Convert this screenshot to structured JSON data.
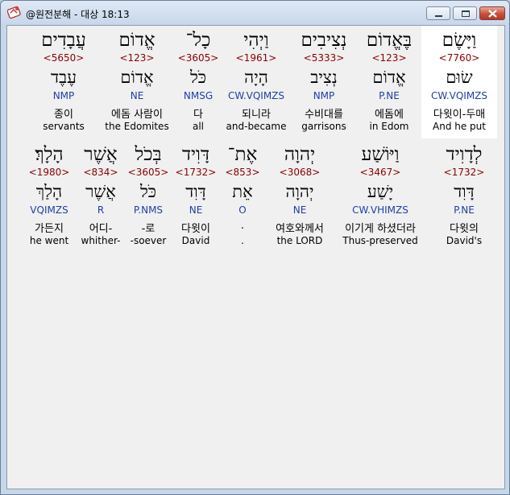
{
  "window": {
    "title": "@원전분해 - 대상 18:13"
  },
  "icons": {
    "app": "bible-app-icon",
    "minimize": "minimize-icon",
    "maximize": "maximize-icon",
    "close": "close-icon"
  },
  "rows": [
    {
      "words": [
        {
          "hebrew": "עֲבָדִים",
          "strong": "<5650>",
          "lemma": "עֶבֶד",
          "parse": "NMP",
          "korean": "종이",
          "english": "servants"
        },
        {
          "hebrew": "אֱדוֹם",
          "strong": "<123>",
          "lemma": "אֱדוֹם",
          "parse": "NE",
          "korean": "에돔 사람이",
          "english": "the Edomites"
        },
        {
          "hebrew": "כָל־",
          "strong": "<3605>",
          "lemma": "כֹּל",
          "parse": "NMSG",
          "korean": "다",
          "english": "all"
        },
        {
          "hebrew": "וַיְהִי",
          "strong": "<1961>",
          "lemma": "הָיָה",
          "parse": "CW.VQIMZS",
          "korean": "되니라",
          "english": "and-became"
        },
        {
          "hebrew": "נְצִיבִים",
          "strong": "<5333>",
          "lemma": "נְצִיב",
          "parse": "NMP",
          "korean": "수비대를",
          "english": "garrisons"
        },
        {
          "hebrew": "בֶּאֱדוֹם",
          "strong": "<123>",
          "lemma": "אֱדוֹם",
          "parse": "P.NE",
          "korean": "에돔에",
          "english": "in Edom"
        },
        {
          "hebrew": "וַיָּשֶׂם",
          "strong": "<7760>",
          "lemma": "שׂוּם",
          "parse": "CW.VQIMZS",
          "korean": "다윗이-두매",
          "english": "And he put",
          "selected": true
        }
      ]
    },
    {
      "words": [
        {
          "hebrew": "הָלָךְ׃",
          "strong": "<1980>",
          "lemma": "הָלַךְ",
          "parse": "VQIMZS",
          "korean": "가든지",
          "english": "he went"
        },
        {
          "hebrew": "אֲשֶׁר",
          "strong": "<834>",
          "lemma": "אֲשֶׁר",
          "parse": "R",
          "korean": "어디-",
          "english": "whither-"
        },
        {
          "hebrew": "בְּכֹל",
          "strong": "<3605>",
          "lemma": "כֹּל",
          "parse": "P.NMS",
          "korean": "-로",
          "english": "-soever"
        },
        {
          "hebrew": "דָּוִיד",
          "strong": "<1732>",
          "lemma": "דָּוִד",
          "parse": "NE",
          "korean": "다윗이",
          "english": "David"
        },
        {
          "hebrew": "אֶת־",
          "strong": "<853>",
          "lemma": "אֵת",
          "parse": "O",
          "korean": ".",
          "english": "."
        },
        {
          "hebrew": "יְהוָה",
          "strong": "<3068>",
          "lemma": "יְהוָה",
          "parse": "NE",
          "korean": "여호와께서",
          "english": "the LORD"
        },
        {
          "hebrew": "וַיּוֹשַׁע",
          "strong": "<3467>",
          "lemma": "יָשַׁע",
          "parse": "CW.VHIMZS",
          "korean": "이기게 하셨더라",
          "english": "Thus-preserved"
        },
        {
          "hebrew": "לְדָוִיד",
          "strong": "<1732>",
          "lemma": "דָּוִד",
          "parse": "P.NE",
          "korean": "다윗의",
          "english": "David's"
        }
      ]
    }
  ]
}
